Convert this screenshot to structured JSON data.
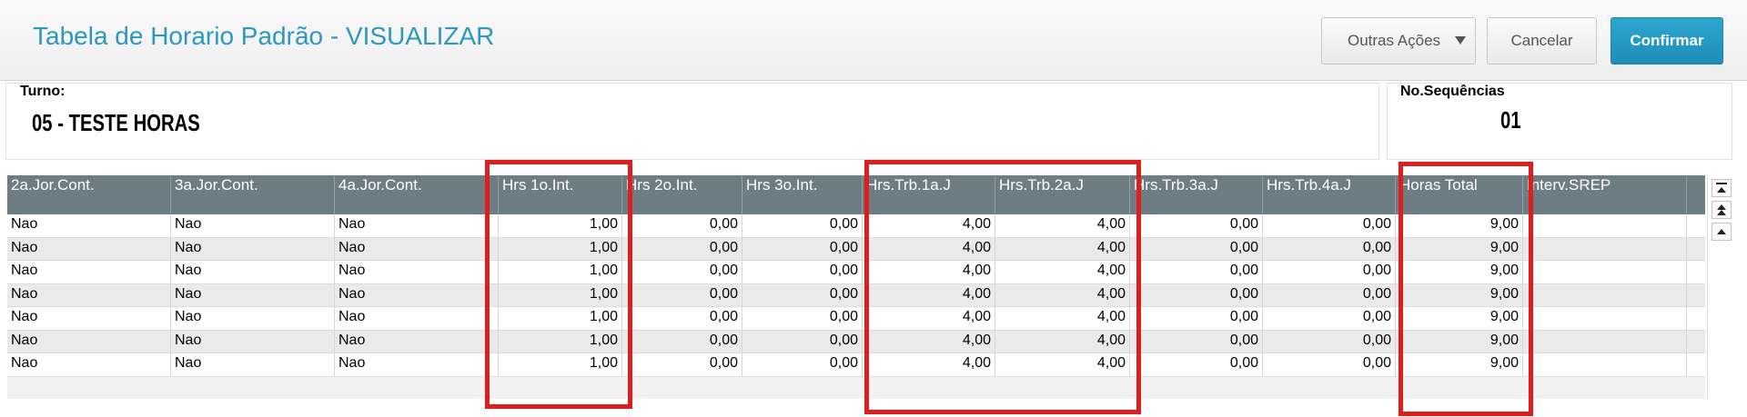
{
  "header": {
    "title": "Tabela de Horario Padrão - VISUALIZAR",
    "buttons": {
      "other_actions": "Outras Ações",
      "cancel": "Cancelar",
      "confirm": "Confirmar"
    }
  },
  "turno": {
    "label": "Turno:",
    "value": "05  - TESTE HORAS"
  },
  "sequencias": {
    "label": "No.Sequências",
    "value": "01"
  },
  "grid": {
    "columns": [
      "2a.Jor.Cont.",
      "3a.Jor.Cont.",
      "4a.Jor.Cont.",
      "Hrs 1o.Int.",
      "Hrs 2o.Int.",
      "Hrs 3o.Int.",
      "Hrs.Trb.1a.J",
      "Hrs.Trb.2a.J",
      "Hrs.Trb.3a.J",
      "Hrs.Trb.4a.J",
      "Horas Total",
      "Interv.SREP"
    ],
    "rows": [
      [
        "Nao",
        "Nao",
        "Nao",
        "1,00",
        "0,00",
        "0,00",
        "4,00",
        "4,00",
        "0,00",
        "0,00",
        "9,00",
        ""
      ],
      [
        "Nao",
        "Nao",
        "Nao",
        "1,00",
        "0,00",
        "0,00",
        "4,00",
        "4,00",
        "0,00",
        "0,00",
        "9,00",
        ""
      ],
      [
        "Nao",
        "Nao",
        "Nao",
        "1,00",
        "0,00",
        "0,00",
        "4,00",
        "4,00",
        "0,00",
        "0,00",
        "9,00",
        ""
      ],
      [
        "Nao",
        "Nao",
        "Nao",
        "1,00",
        "0,00",
        "0,00",
        "4,00",
        "4,00",
        "0,00",
        "0,00",
        "9,00",
        ""
      ],
      [
        "Nao",
        "Nao",
        "Nao",
        "1,00",
        "0,00",
        "0,00",
        "4,00",
        "4,00",
        "0,00",
        "0,00",
        "9,00",
        ""
      ],
      [
        "Nao",
        "Nao",
        "Nao",
        "1,00",
        "0,00",
        "0,00",
        "4,00",
        "4,00",
        "0,00",
        "0,00",
        "9,00",
        ""
      ],
      [
        "Nao",
        "Nao",
        "Nao",
        "1,00",
        "0,00",
        "0,00",
        "4,00",
        "4,00",
        "0,00",
        "0,00",
        "9,00",
        ""
      ]
    ]
  },
  "scroll_icons": [
    "scroll-top-icon",
    "page-up-icon",
    "line-up-icon"
  ],
  "colors": {
    "title": "#2c98c0",
    "confirm_button": "#2ea6cf",
    "grid_header": "#6e7d84",
    "highlight_box": "#dd1e1e"
  }
}
